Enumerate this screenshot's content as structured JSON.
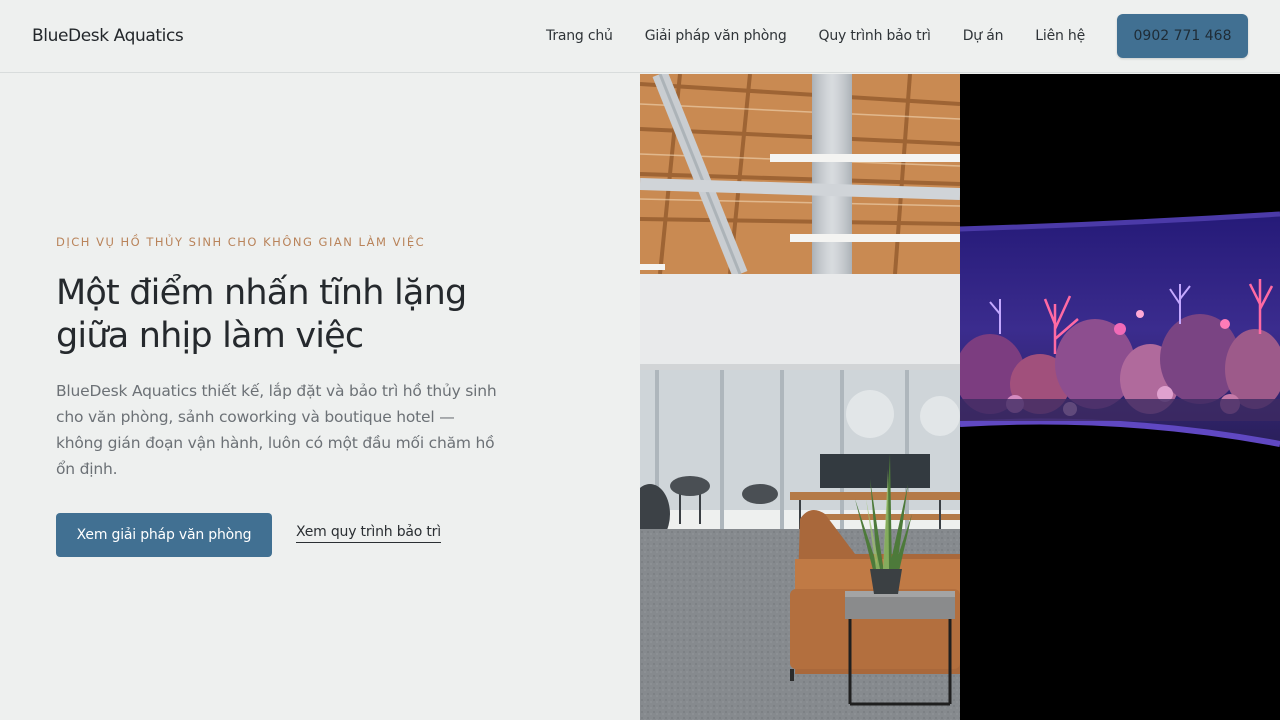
{
  "header": {
    "brand": "BlueDesk Aquatics",
    "nav": [
      {
        "label": "Trang chủ"
      },
      {
        "label": "Giải pháp văn phòng"
      },
      {
        "label": "Quy trình bảo trì"
      },
      {
        "label": "Dự án"
      },
      {
        "label": "Liên hệ"
      }
    ],
    "phone": "0902 771 468"
  },
  "hero": {
    "eyebrow": "DỊCH VỤ HỒ THỦY SINH CHO KHÔNG GIAN LÀM VIỆC",
    "headline_line1": "Một điểm nhấn tĩnh lặng",
    "headline_line2": "giữa nhịp làm việc",
    "intro": "BlueDesk Aquatics thiết kế, lắp đặt và bảo trì hồ thủy sinh cho văn phòng, sảnh coworking và boutique hotel — không gián đoạn vận hành, luôn có một đầu mối chăm hồ ổn định.",
    "cta_primary": "Xem giải pháp văn phòng",
    "cta_secondary": "Xem quy trình bảo trì"
  },
  "colors": {
    "accent": "#417092",
    "eyebrow": "#b9835a",
    "background": "#eef0ef"
  }
}
